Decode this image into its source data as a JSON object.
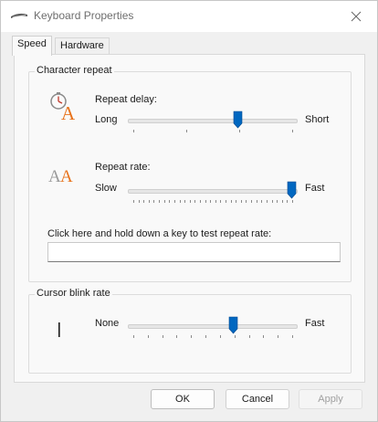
{
  "window": {
    "title": "Keyboard Properties",
    "icon": "keyboard-icon",
    "close_icon": "close-icon"
  },
  "tabs": [
    {
      "label": "Speed",
      "active": true
    },
    {
      "label": "Hardware",
      "active": false
    }
  ],
  "character_repeat": {
    "group_label": "Character repeat",
    "repeat_delay": {
      "label": "Repeat delay:",
      "min_label": "Long",
      "max_label": "Short",
      "icon": "stopwatch-letter-a-icon",
      "tick_count": 4,
      "value_fraction": 0.66
    },
    "repeat_rate": {
      "label": "Repeat rate:",
      "min_label": "Slow",
      "max_label": "Fast",
      "icon": "double-letter-a-icon",
      "tick_count": 32,
      "value_fraction": 1.0
    },
    "test_label": "Click here and hold down a key to test repeat rate:",
    "test_value": ""
  },
  "cursor_blink": {
    "group_label": "Cursor blink rate",
    "min_label": "None",
    "max_label": "Fast",
    "cursor_icon": "text-cursor-icon",
    "tick_count": 12,
    "value_fraction": 0.63
  },
  "buttons": {
    "ok": "OK",
    "cancel": "Cancel",
    "apply": "Apply"
  },
  "colors": {
    "accent": "#0067c0",
    "icon_orange": "#e8731c"
  }
}
